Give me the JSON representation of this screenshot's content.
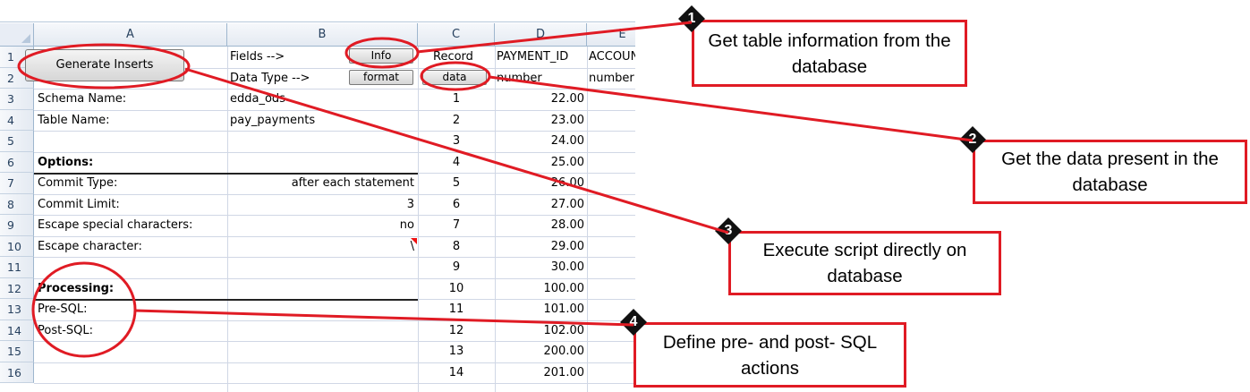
{
  "sheet": {
    "columns": [
      "A",
      "B",
      "C",
      "D",
      "E"
    ],
    "rows": [
      "1",
      "2",
      "3",
      "4",
      "5",
      "6",
      "7",
      "8",
      "9",
      "10",
      "11",
      "12",
      "13",
      "14",
      "15",
      "16"
    ],
    "generate_button": "Generate Inserts",
    "fields_label": "Fields -->",
    "datatype_label": "Data Type -->",
    "info_button": "Info",
    "format_button": "format",
    "data_button": "data",
    "record_header": "Record",
    "payment_id_header": "PAYMENT_ID",
    "account_header": "ACCOUNT",
    "payment_type": "number",
    "account_type": "number",
    "schema_label": "Schema Name:",
    "schema_value": "edda_ods",
    "table_label": "Table Name:",
    "table_value": "pay_payments",
    "options_label": "Options:",
    "commit_type_label": "Commit Type:",
    "commit_type_value": "after each statement",
    "commit_limit_label": "Commit Limit:",
    "commit_limit_value": "3",
    "escape_special_label": "Escape special characters:",
    "escape_special_value": "no",
    "escape_char_label": "Escape character:",
    "escape_char_value": "\\",
    "processing_label": "Processing:",
    "pre_sql_label": "Pre-SQL:",
    "post_sql_label": "Post-SQL:",
    "records": [
      "1",
      "2",
      "3",
      "4",
      "5",
      "6",
      "7",
      "8",
      "9",
      "10",
      "11",
      "12",
      "13",
      "14"
    ],
    "payment_ids": [
      "22.00",
      "23.00",
      "24.00",
      "25.00",
      "26.00",
      "27.00",
      "28.00",
      "29.00",
      "30.00",
      "100.00",
      "101.00",
      "102.00",
      "200.00",
      "201.00"
    ]
  },
  "callouts": [
    {
      "number": "1",
      "text": "Get table information from the database"
    },
    {
      "number": "2",
      "text": "Get the data present in the database"
    },
    {
      "number": "3",
      "text": "Execute script directly on database"
    },
    {
      "number": "4",
      "text": "Define pre- and post- SQL actions"
    }
  ],
  "colors": {
    "annotation": "#e01b24",
    "badge": "#111111"
  }
}
